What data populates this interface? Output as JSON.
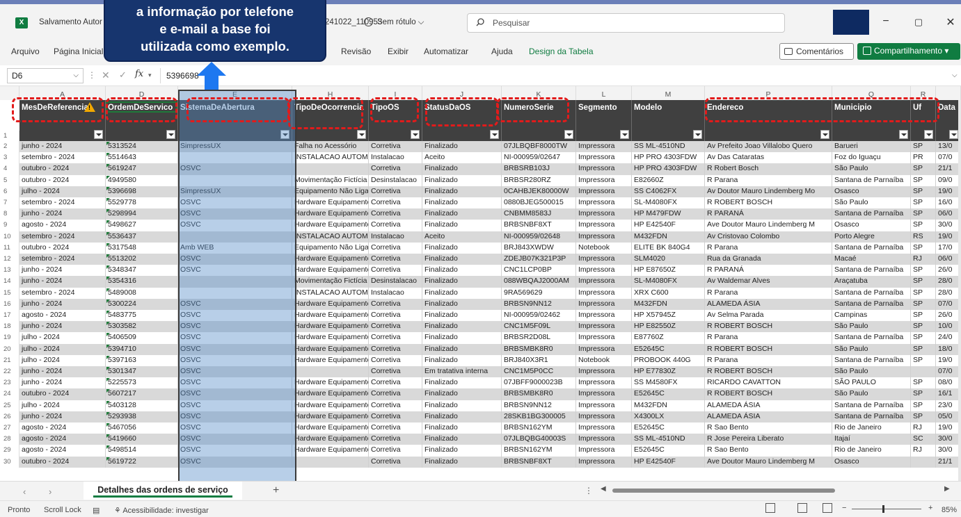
{
  "titlebar": {
    "app_icon": "X",
    "title_left": "Salvamento Autor",
    "title_right": "241022_110953",
    "sensitivity": "Sem rótulo",
    "search_placeholder": "Pesquisar",
    "account_color": "#0e2a61"
  },
  "ribbon": {
    "tabs": [
      "Arquivo",
      "Página Inicial",
      "Revisão",
      "Exibir",
      "Automatizar",
      "Ajuda",
      "Design da Tabela"
    ],
    "comments_label": "Comentários",
    "share_label": "Compartilhamento"
  },
  "formula": {
    "name_box": "D6",
    "fx_label": "fx",
    "content": "5396698"
  },
  "callout": {
    "lines": [
      "a informação por telefone",
      "e e-mail a base foi",
      "utilizada como exemplo."
    ]
  },
  "columns": [
    {
      "letter": "A",
      "header": "MesDeReferencia"
    },
    {
      "letter": "D",
      "header": "OrdemDeServico"
    },
    {
      "letter": "E",
      "header": "SistemaDeAbertura"
    },
    {
      "letter": "H",
      "header": "TipoDeOcorrencia"
    },
    {
      "letter": "I",
      "header": "TipoOS"
    },
    {
      "letter": "J",
      "header": "StatusDaOS"
    },
    {
      "letter": "K",
      "header": "NumeroSerie"
    },
    {
      "letter": "L",
      "header": "Segmento"
    },
    {
      "letter": "M",
      "header": "Modelo"
    },
    {
      "letter": "P",
      "header": "Endereco"
    },
    {
      "letter": "Q",
      "header": "Municipio"
    },
    {
      "letter": "R",
      "header": "Uf"
    },
    {
      "letter": "",
      "header": "Data"
    }
  ],
  "rows": [
    {
      "n": "2",
      "c": [
        "junho - 2024",
        "5313524",
        "SimpressUX",
        "Falha no Acessório",
        "Corretiva",
        "Finalizado",
        "07JLBQBF8000TW",
        "Impressora",
        "SS ML-4510ND",
        "Av Prefeito Joao Villalobo Quero",
        "Barueri",
        "SP",
        "13/0"
      ]
    },
    {
      "n": "3",
      "c": [
        "setembro - 2024",
        "5514643",
        "",
        "INSTALACAO AUTOM.",
        "Instalacao",
        "Aceito",
        "NI-000959/02647",
        "Impressora",
        "HP PRO 4303FDW",
        "Av Das Cataratas",
        "Foz do Iguaçu",
        "PR",
        "07/0"
      ]
    },
    {
      "n": "4",
      "c": [
        "outubro - 2024",
        "5619247",
        "OSVC",
        "",
        "Corretiva",
        "Finalizado",
        "BRBSRB103J",
        "Impressora",
        "HP PRO 4303FDW",
        "R Robert Bosch",
        "São Paulo",
        "SP",
        "21/1"
      ]
    },
    {
      "n": "5",
      "c": [
        "outubro - 2024",
        "4949580",
        "",
        "Movimentação Fictícia",
        "Desinstalacao",
        "Finalizado",
        "BRBSR280RZ",
        "Impressora",
        "E82660Z",
        "R Parana",
        "Santana de Parnaíba",
        "SP",
        "09/0"
      ]
    },
    {
      "n": "6",
      "c": [
        "julho - 2024",
        "5396698",
        "SimpressUX",
        "Equipamento Não Liga",
        "Corretiva",
        "Finalizado",
        "0CAHBJEK80000W",
        "Impressora",
        "SS C4062FX",
        "Av Doutor Mauro Lindemberg Mo",
        "Osasco",
        "SP",
        "19/0"
      ]
    },
    {
      "n": "7",
      "c": [
        "setembro - 2024",
        "5529778",
        "OSVC",
        "Hardware Equipamento",
        "Corretiva",
        "Finalizado",
        "0880BJEG500015",
        "Impressora",
        "SL-M4080FX",
        "R ROBERT BOSCH",
        "São Paulo",
        "SP",
        "16/0"
      ]
    },
    {
      "n": "8",
      "c": [
        "junho - 2024",
        "5298994",
        "OSVC",
        "Hardware Equipamento",
        "Corretiva",
        "Finalizado",
        "CNBMM8583J",
        "Impressora",
        "HP M479FDW",
        "R PARANÁ",
        "Santana de Parnaíba",
        "SP",
        "06/0"
      ]
    },
    {
      "n": "9",
      "c": [
        "agosto - 2024",
        "5498627",
        "OSVC",
        "Hardware Equipamento",
        "Corretiva",
        "Finalizado",
        "BRBSNBF8XT",
        "Impressora",
        "HP E42540F",
        "Ave Doutor Mauro Lindemberg M",
        "Osasco",
        "SP",
        "30/0"
      ]
    },
    {
      "n": "10",
      "c": [
        "setembro - 2024",
        "5536437",
        "",
        "INSTALACAO AUTOM.",
        "Instalacao",
        "Aceito",
        "NI-000959/02648",
        "Impressora",
        "M432FDN",
        "Av Cristovao Colombo",
        "Porto Alegre",
        "RS",
        "19/0"
      ]
    },
    {
      "n": "11",
      "c": [
        "outubro - 2024",
        "5317548",
        "Amb WEB",
        "Equipamento Não Liga",
        "Corretiva",
        "Finalizado",
        "BRJ843XWDW",
        "Notebook",
        "ELITE BK 840G4",
        "R Parana",
        "Santana de Parnaíba",
        "SP",
        "17/0"
      ]
    },
    {
      "n": "12",
      "c": [
        "setembro - 2024",
        "5513202",
        "OSVC",
        "Hardware Equipamento",
        "Corretiva",
        "Finalizado",
        "ZDEJB07K321P3P",
        "Impressora",
        "SLM4020",
        "Rua da Granada",
        "Macaé",
        "RJ",
        "06/0"
      ]
    },
    {
      "n": "13",
      "c": [
        "junho - 2024",
        "5348347",
        "OSVC",
        "Hardware Equipamento",
        "Corretiva",
        "Finalizado",
        "CNC1LCP0BP",
        "Impressora",
        "HP E87650Z",
        "R PARANÁ",
        "Santana de Parnaíba",
        "SP",
        "26/0"
      ]
    },
    {
      "n": "14",
      "c": [
        "junho - 2024",
        "5354316",
        "",
        "Movimentação Fictícia",
        "Desinstalacao",
        "Finalizado",
        "088WBQAJ2000AM",
        "Impressora",
        "SL-M4080FX",
        "Av Waldemar Alves",
        "Araçatuba",
        "SP",
        "28/0"
      ]
    },
    {
      "n": "15",
      "c": [
        "setembro - 2024",
        "5489008",
        "",
        "INSTALACAO AUTOM.",
        "Instalacao",
        "Finalizado",
        "9RA569629",
        "Impressora",
        "XRX C600",
        "R Parana",
        "Santana de Parnaíba",
        "SP",
        "28/0"
      ]
    },
    {
      "n": "16",
      "c": [
        "junho - 2024",
        "5300224",
        "OSVC",
        "Hardware Equipamento",
        "Corretiva",
        "Finalizado",
        "BRBSN9NN12",
        "Impressora",
        "M432FDN",
        "ALAMEDA ÁSIA",
        "Santana de Parnaíba",
        "SP",
        "07/0"
      ]
    },
    {
      "n": "17",
      "c": [
        "agosto - 2024",
        "5483775",
        "OSVC",
        "Hardware Equipamento",
        "Corretiva",
        "Finalizado",
        "NI-000959/02462",
        "Impressora",
        "HP X57945Z",
        "Av Selma Parada",
        "Campinas",
        "SP",
        "26/0"
      ]
    },
    {
      "n": "18",
      "c": [
        "junho - 2024",
        "5303582",
        "OSVC",
        "Hardware Equipamento",
        "Corretiva",
        "Finalizado",
        "CNC1M5F09L",
        "Impressora",
        "HP E82550Z",
        "R ROBERT BOSCH",
        "São Paulo",
        "SP",
        "10/0"
      ]
    },
    {
      "n": "19",
      "c": [
        "julho - 2024",
        "5406509",
        "OSVC",
        "Hardware Equipamento",
        "Corretiva",
        "Finalizado",
        "BRBSR2D08L",
        "Impressora",
        "E87760Z",
        "R Parana",
        "Santana de Parnaíba",
        "SP",
        "24/0"
      ]
    },
    {
      "n": "20",
      "c": [
        "julho - 2024",
        "5394710",
        "OSVC",
        "Hardware Equipamento",
        "Corretiva",
        "Finalizado",
        "BRBSMBK8R0",
        "Impressora",
        "E52645C",
        "R ROBERT BOSCH",
        "São Paulo",
        "SP",
        "18/0"
      ]
    },
    {
      "n": "21",
      "c": [
        "julho - 2024",
        "5397163",
        "OSVC",
        "Hardware Equipamento",
        "Corretiva",
        "Finalizado",
        "BRJ840X3R1",
        "Notebook",
        "PROBOOK 440G",
        "R Parana",
        "Santana de Parnaíba",
        "SP",
        "19/0"
      ]
    },
    {
      "n": "22",
      "c": [
        "junho - 2024",
        "5301347",
        "OSVC",
        "",
        "Corretiva",
        "Em tratativa interna",
        "CNC1M5P0CC",
        "Impressora",
        "HP E77830Z",
        "R ROBERT BOSCH",
        "São Paulo",
        "",
        "07/0"
      ]
    },
    {
      "n": "23",
      "c": [
        "junho - 2024",
        "5225573",
        "OSVC",
        "Hardware Equipamento",
        "Corretiva",
        "Finalizado",
        "07JBFF9000023B",
        "Impressora",
        "SS M4580FX",
        "RICARDO CAVATTON",
        "SÃO PAULO",
        "SP",
        "08/0"
      ]
    },
    {
      "n": "24",
      "c": [
        "outubro - 2024",
        "5607217",
        "OSVC",
        "Hardware Equipamento",
        "Corretiva",
        "Finalizado",
        "BRBSMBK8R0",
        "Impressora",
        "E52645C",
        "R ROBERT BOSCH",
        "São Paulo",
        "SP",
        "16/1"
      ]
    },
    {
      "n": "25",
      "c": [
        "julho - 2024",
        "5403128",
        "OSVC",
        "Hardware Equipamento",
        "Corretiva",
        "Finalizado",
        "BRBSN9NN12",
        "Impressora",
        "M432FDN",
        "ALAMEDA ÁSIA",
        "Santana de Parnaíba",
        "SP",
        "23/0"
      ]
    },
    {
      "n": "26",
      "c": [
        "junho - 2024",
        "5293938",
        "OSVC",
        "Hardware Equipamento",
        "Corretiva",
        "Finalizado",
        "28SKB1BG300005",
        "Impressora",
        "X4300LX",
        "ALAMEDA ÁSIA",
        "Santana de Parnaíba",
        "SP",
        "05/0"
      ]
    },
    {
      "n": "27",
      "c": [
        "agosto - 2024",
        "5467056",
        "OSVC",
        "Hardware Equipamento",
        "Corretiva",
        "Finalizado",
        "BRBSN162YM",
        "Impressora",
        "E52645C",
        "R Sao Bento",
        "Rio de Janeiro",
        "RJ",
        "19/0"
      ]
    },
    {
      "n": "28",
      "c": [
        "agosto - 2024",
        "5419660",
        "OSVC",
        "Hardware Equipamento",
        "Corretiva",
        "Finalizado",
        "07JLBQBG40003S",
        "Impressora",
        "SS ML-4510ND",
        "R Jose Pereira Liberato",
        "Itajaí",
        "SC",
        "30/0"
      ]
    },
    {
      "n": "29",
      "c": [
        "agosto - 2024",
        "5498514",
        "OSVC",
        "Hardware Equipamento",
        "Corretiva",
        "Finalizado",
        "BRBSN162YM",
        "Impressora",
        "E52645C",
        "R Sao Bento",
        "Rio de Janeiro",
        "RJ",
        "30/0"
      ]
    },
    {
      "n": "30",
      "c": [
        "outubro - 2024",
        "5619722",
        "OSVC",
        "",
        "Corretiva",
        "Finalizado",
        "BRBSNBF8XT",
        "Impressora",
        "HP E42540F",
        "Ave Doutor Mauro Lindemberg M",
        "Osasco",
        "",
        "21/1"
      ]
    }
  ],
  "sheets": {
    "active": "Detalhes das ordens de serviço",
    "add_label": "+"
  },
  "status": {
    "ready": "Pronto",
    "scroll_lock": "Scroll Lock",
    "accessibility": "Acessibilidade: investigar",
    "zoom": "85%"
  },
  "colors": {
    "header_bg": "#404040",
    "excel_green": "#107c41",
    "highlight_red": "#e21b1b",
    "callout_bg": "#17356e",
    "arrow_blue": "#1e78f0"
  },
  "icons": [
    "excel-logo-icon",
    "sensitivity-icon",
    "search-icon",
    "minimize-icon",
    "maximize-icon",
    "close-icon",
    "comments-icon",
    "share-icon",
    "filter-dropdown-icon",
    "warning-icon",
    "normal-view-icon",
    "page-layout-icon",
    "page-break-icon"
  ]
}
